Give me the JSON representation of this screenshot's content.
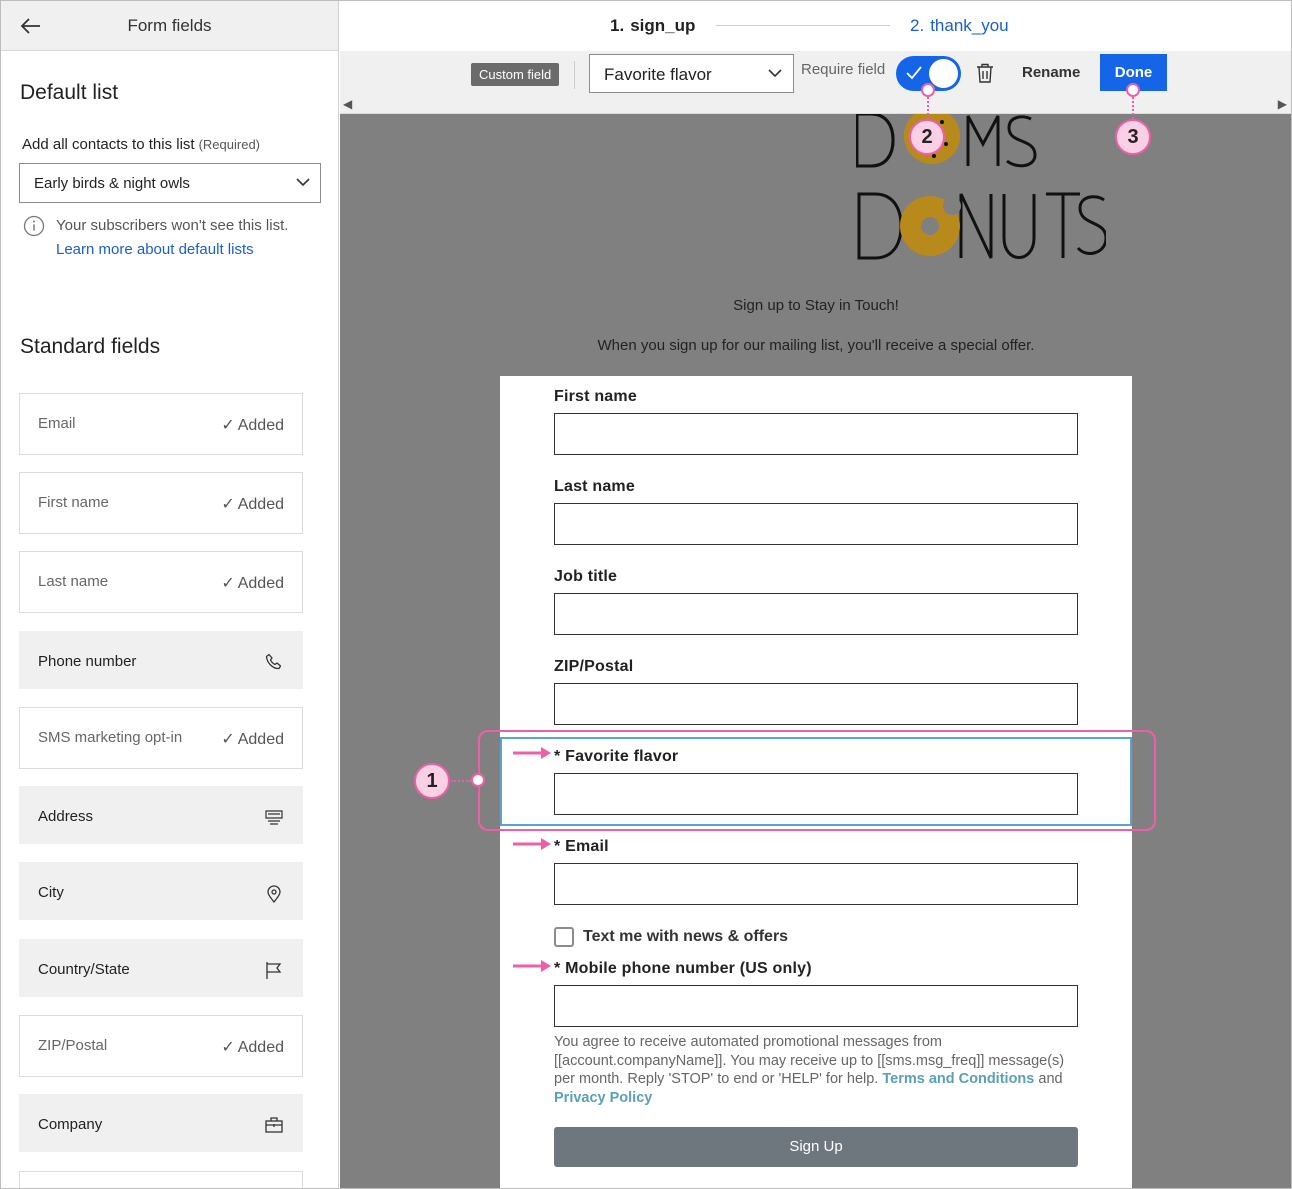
{
  "sidebar": {
    "title": "Form fields",
    "default_list": {
      "heading": "Default list",
      "label": "Add all contacts to this list",
      "required": "(Required)",
      "selected": "Early birds & night owls",
      "info_text": "Your subscribers won't see this list.",
      "info_link": "Learn more about default lists"
    },
    "standard_heading": "Standard fields",
    "added_text": "Added",
    "fields": [
      {
        "label": "Email",
        "state": "added"
      },
      {
        "label": "First name",
        "state": "added"
      },
      {
        "label": "Last name",
        "state": "added"
      },
      {
        "label": "Phone number",
        "state": "available",
        "icon": "phone-icon"
      },
      {
        "label": "SMS marketing opt-in",
        "state": "added"
      },
      {
        "label": "Address",
        "state": "available",
        "icon": "address-icon"
      },
      {
        "label": "City",
        "state": "available",
        "icon": "location-pin-icon"
      },
      {
        "label": "Country/State",
        "state": "available",
        "icon": "flag-icon"
      },
      {
        "label": "ZIP/Postal",
        "state": "added"
      },
      {
        "label": "Company",
        "state": "available",
        "icon": "briefcase-icon"
      }
    ]
  },
  "steps": [
    {
      "num": "1.",
      "label": "sign_up",
      "active": true
    },
    {
      "num": "2.",
      "label": "thank_you",
      "active": false
    }
  ],
  "toolbar": {
    "badge": "Custom field",
    "field_select": "Favorite flavor",
    "require_label": "Require field",
    "require_on": true,
    "rename": "Rename",
    "done": "Done"
  },
  "email": {
    "tagline": "Sign up to Stay in Touch!",
    "offer": "When you sign up for our mailing list, you'll receive a special offer.",
    "fields": {
      "first_name": "First name",
      "last_name": "Last name",
      "job_title": "Job title",
      "zip": "ZIP/Postal",
      "favorite_flavor": "Favorite flavor",
      "email": "Email",
      "mobile": "Mobile phone number (US only)"
    },
    "required_mark": "*",
    "sms_checkbox": "Text me with news & offers",
    "legal_text": "You agree to receive automated promotional messages from [[account.companyName]]. You may receive up to [[sms.msg_freq]] message(s) per month. Reply 'STOP' to end or 'HELP' for help.",
    "legal_terms": "Terms and Conditions",
    "legal_and": "and",
    "legal_privacy": "Privacy Policy",
    "submit": "Sign Up"
  },
  "callouts": [
    "1",
    "2",
    "3"
  ],
  "colors": {
    "accent": "#1565e8",
    "callout": "#ef5fa7",
    "selection": "#5ba3d0",
    "logo_gold": "#b8860b",
    "canvas": "#808080"
  }
}
